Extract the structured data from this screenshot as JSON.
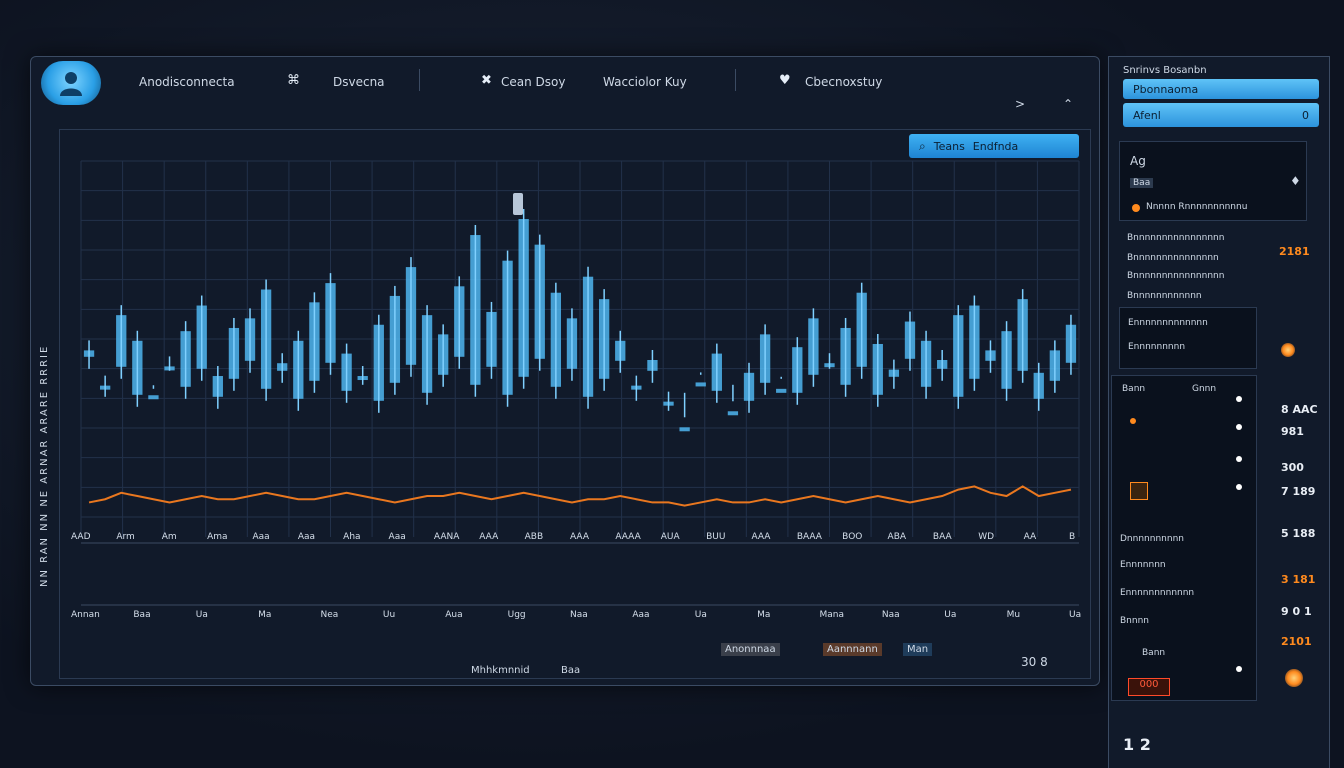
{
  "header": {
    "app_title": "Anodisconnecta",
    "nav_item_1": "Dsvecna",
    "nav_item_2": "Cean Dsoy",
    "nav_item_3": "Wacciolor Kuy",
    "nav_item_4": "Cbecnoxstuy",
    "arrow_right": ">",
    "arrow_caret": "⌃"
  },
  "chart_badge": {
    "icon": "search-icon",
    "label": "Teans",
    "label2": "Endfnda"
  },
  "ylabel": "NN RAN NN NE ARNAR ARARE RRRIE",
  "x_ticks_upper": [
    "AAD",
    "Arm",
    "Am",
    "Ama",
    "Aaa",
    "Aaa",
    "Aha",
    "Aaa",
    "AANA",
    "AAA",
    "ABB",
    "AAA",
    "AAAA",
    "AUA",
    "BUU",
    "AAA",
    "BAAA",
    "BOO",
    "ABA",
    "BAA",
    "WD",
    "AA",
    "B"
  ],
  "x_ticks_lower": [
    "Annan",
    "Baa",
    "Ua",
    "Ma",
    "Nea",
    "Uu",
    "Aua",
    "Ugg",
    "Naa",
    "Aaa",
    "Ua",
    "Ma",
    "Mana",
    "Naa",
    "Ua",
    "Mu",
    "Ua"
  ],
  "footer": {
    "label_a": "Ma",
    "label_b": "Ma",
    "status": "Mhhkmnnid",
    "status2": "Baa",
    "chip1": "Anonnnaa",
    "chip2": "Aannnann",
    "chip3": "Man",
    "readout": "30 8"
  },
  "chart_data": {
    "type": "bar",
    "title": "",
    "xlabel": "",
    "ylabel": "",
    "series": [
      {
        "name": "",
        "color": "#4fb6f0",
        "values": [
          0.52,
          0.41,
          0.63,
          0.55,
          0.38,
          0.47,
          0.58,
          0.66,
          0.44,
          0.59,
          0.62,
          0.71,
          0.48,
          0.55,
          0.67,
          0.73,
          0.51,
          0.44,
          0.6,
          0.69,
          0.78,
          0.63,
          0.57,
          0.72,
          0.88,
          0.64,
          0.8,
          0.93,
          0.85,
          0.7,
          0.62,
          0.75,
          0.68,
          0.55,
          0.41,
          0.49,
          0.36,
          0.28,
          0.42,
          0.51,
          0.33,
          0.45,
          0.57,
          0.4,
          0.53,
          0.62,
          0.48,
          0.59,
          0.7,
          0.54,
          0.46,
          0.61,
          0.55,
          0.49,
          0.63,
          0.66,
          0.52,
          0.58,
          0.68,
          0.45,
          0.52,
          0.6
        ]
      }
    ],
    "trend": {
      "name": "",
      "color": "#e9771f",
      "values": [
        0.42,
        0.43,
        0.45,
        0.44,
        0.43,
        0.42,
        0.43,
        0.44,
        0.43,
        0.43,
        0.44,
        0.45,
        0.44,
        0.43,
        0.43,
        0.44,
        0.45,
        0.44,
        0.43,
        0.42,
        0.43,
        0.44,
        0.44,
        0.45,
        0.44,
        0.43,
        0.44,
        0.45,
        0.44,
        0.43,
        0.42,
        0.43,
        0.43,
        0.44,
        0.43,
        0.42,
        0.42,
        0.41,
        0.42,
        0.43,
        0.42,
        0.42,
        0.43,
        0.42,
        0.43,
        0.44,
        0.43,
        0.42,
        0.43,
        0.44,
        0.43,
        0.42,
        0.43,
        0.44,
        0.46,
        0.47,
        0.45,
        0.44,
        0.47,
        0.44,
        0.45,
        0.46
      ]
    },
    "grid": true
  },
  "right_panel": {
    "head": "Snrinvs Bosanbn",
    "btn1": "Pbonnaoma",
    "btn2": "Afenl",
    "btn2_right": "0",
    "card1_title": "Ag",
    "card1_sub": "Baa",
    "card1_row": "Nnnnn  Rnnnnnnnnnnu",
    "list": [
      "Bnnnnnnnnnnnnnnnn",
      "Bnnnnnnnnnnnnnnn",
      "Bnnnnnnnnnnnnnnnn",
      "Bnnnnnnnnnnnn"
    ],
    "value_a": "2181",
    "card2_row1": "Ennnnnnnnnnnnn",
    "card2_row2": "Ennnnnnnnn",
    "card3_title": "Bann",
    "card3_sub": "Gnnn",
    "rows": [
      "Dnnnnnnnnnn",
      "Ennnnnnn",
      "Ennnnnnnnnnnn",
      "Bnnnn",
      "Bann"
    ],
    "nums": [
      "8 AAC",
      "981",
      "300",
      "7 189",
      "5 188",
      "3 181",
      "9 0 1",
      "2101"
    ],
    "mini_display": "000",
    "bottom_value": "1 2"
  }
}
